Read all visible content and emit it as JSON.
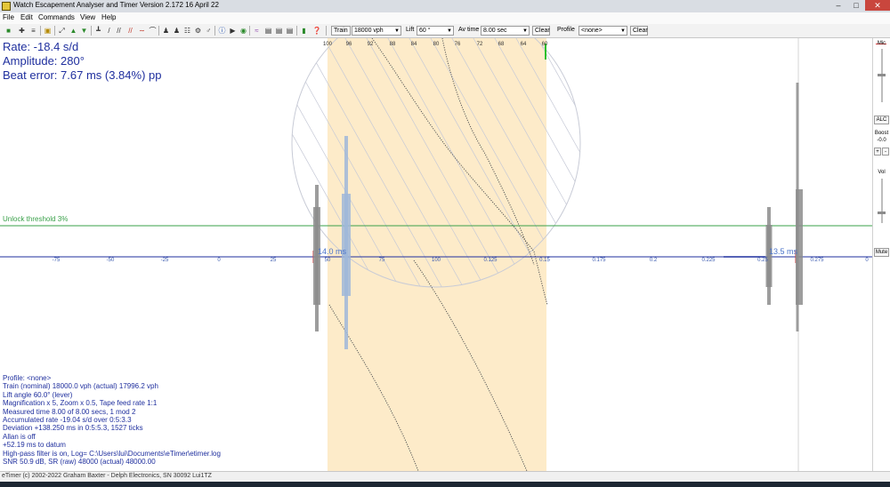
{
  "window": {
    "title": "Watch Escapement Analyser and Timer  Version 2.172 16 April 22",
    "min": "–",
    "max": "□",
    "close": "✕"
  },
  "menu": [
    "File",
    "Edit",
    "Commands",
    "View",
    "Help"
  ],
  "toolbar": {
    "train_button": "Train",
    "train_value": "18000 vph",
    "lift_label": "Lift",
    "lift_value": "60 °",
    "avtime_label": "Av time",
    "avtime_value": "8.00 sec",
    "clear_label": "Clear",
    "profile_label": "Profile",
    "profile_value": "<none>",
    "clear2_label": "Clear",
    "dropdown_arrow": "▼"
  },
  "readouts": {
    "rate": "Rate: -18.4 s/d",
    "amplitude": "Amplitude: 280°",
    "beat_error": "Beat error: 7.67 ms (3.84%) pp"
  },
  "threshold_label": "Unlock threshold 3%",
  "ms_labels": [
    "14.0 ms",
    "13.5 ms"
  ],
  "trace_top_scale": [
    "100",
    "96",
    "92",
    "88",
    "84",
    "80",
    "76",
    "72",
    "68",
    "64",
    "60"
  ],
  "x_axis_ticks": [
    "-75",
    "-50",
    "-25",
    "0",
    "25",
    "50",
    "75",
    "100",
    "0.125",
    "0.15",
    "0.175",
    "0.2",
    "0.225",
    "0.25",
    "0.275",
    "0"
  ],
  "stats": [
    "Profile: <none>",
    "Train (nominal) 18000.0 vph (actual) 17996.2 vph",
    "Lift angle 60.0° (lever)",
    "Magnification x 5, Zoom x 0.5, Tape feed rate 1:1",
    "Measured time 8.00 of 8.00 secs, 1 mod 2",
    "Accumulated rate -19.04 s/d over 0:5:3.3",
    "Deviation +138.250 ms in 0:5:5.3, 1527 ticks",
    "Allan is off",
    "+52.19 ms to datum",
    "High-pass filter is on,    Log= C:\\Users\\lui\\Documents\\eTimer\\etimer.log",
    "SNR 50.9 dB, SR (raw) 48000 (actual) 48000.00"
  ],
  "side_panel": {
    "mic": "Mic",
    "alc": "ALC",
    "boost": "Boost",
    "boost_value": "-0.0",
    "plus": "+",
    "minus": "-",
    "vol": "Vol",
    "mute": "Mute"
  },
  "status_bar": "eTimer (c) 2002-2022 Graham Baxter - Delph Electronics, SN 30092 Lui1TZ",
  "colors": {
    "readout_text": "#1f2f9e",
    "threshold_line": "#3aa14a",
    "band_fill": "#fdebc9",
    "axis_line": "#1f2f9e",
    "pulse_gray": "#8c8c8c",
    "pulse_blue": "#9fb7d9"
  }
}
